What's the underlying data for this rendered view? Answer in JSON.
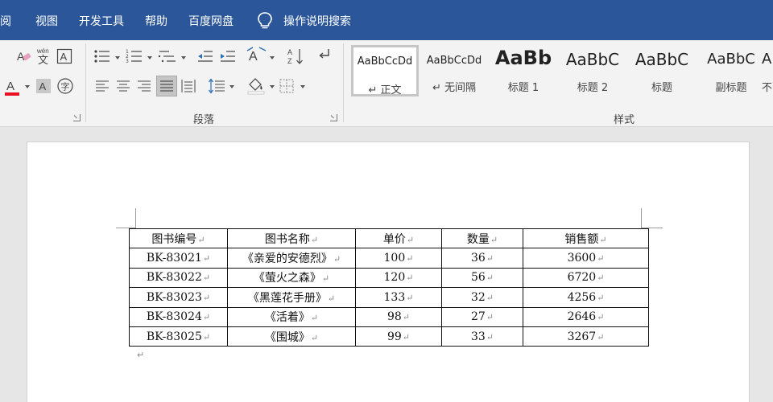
{
  "menu": {
    "items": [
      "审阅",
      "视图",
      "开发工具",
      "帮助",
      "百度网盘"
    ],
    "search_label": "操作说明搜索"
  },
  "ribbon": {
    "group_paragraph": "段落",
    "group_styles": "样式",
    "pinyin_label": "wén",
    "styles": [
      {
        "sample": "AaBbCcDd",
        "name": "↵ 正文"
      },
      {
        "sample": "AaBbCcDd",
        "name": "↵ 无间隔"
      },
      {
        "sample": "AaBb",
        "name": "标题 1"
      },
      {
        "sample": "AaBbC",
        "name": "标题 2"
      },
      {
        "sample": "AaBbC",
        "name": "标题"
      },
      {
        "sample": "AaBbC",
        "name": "副标题"
      },
      {
        "sample": "A",
        "name": "不"
      }
    ]
  },
  "colors": {
    "menubar_bg": "#2b579a",
    "font_color_bar": "#e81123"
  },
  "table": {
    "headers": [
      "图书编号",
      "图书名称",
      "单价",
      "数量",
      "销售额"
    ],
    "rows": [
      [
        "BK-83021",
        "《亲爱的安德烈》",
        "100",
        "36",
        "3600"
      ],
      [
        "BK-83022",
        "《萤火之森》",
        "120",
        "56",
        "6720"
      ],
      [
        "BK-83023",
        "《黑莲花手册》",
        "133",
        "32",
        "4256"
      ],
      [
        "BK-83024",
        "《活着》",
        "98",
        "27",
        "2646"
      ],
      [
        "BK-83025",
        "《围城》",
        "99",
        "33",
        "3267"
      ]
    ],
    "cell_mark": "↵"
  },
  "paragraph_mark": "↵"
}
